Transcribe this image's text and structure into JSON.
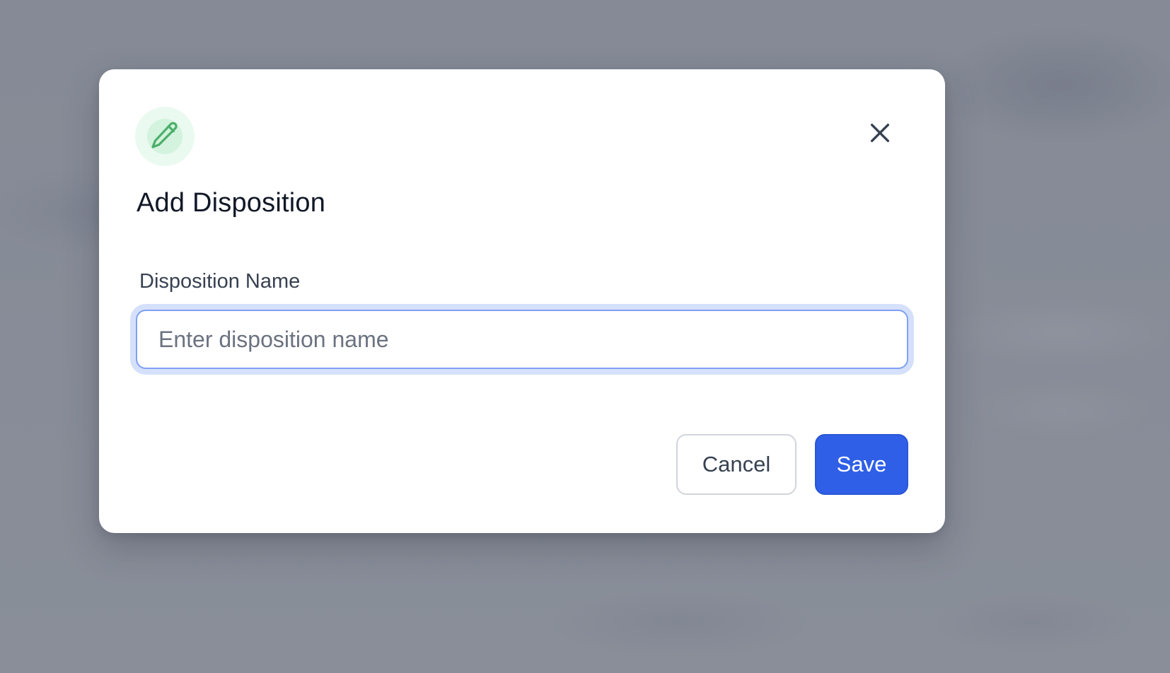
{
  "dialog": {
    "title": "Add Disposition",
    "icon": "pencil-icon",
    "close_icon": "close-icon",
    "accent_color": "#2f5fe6",
    "icon_color": "#4caf6a"
  },
  "form": {
    "name_label": "Disposition Name",
    "name_placeholder": "Enter disposition name",
    "name_value": ""
  },
  "actions": {
    "cancel_label": "Cancel",
    "save_label": "Save"
  }
}
